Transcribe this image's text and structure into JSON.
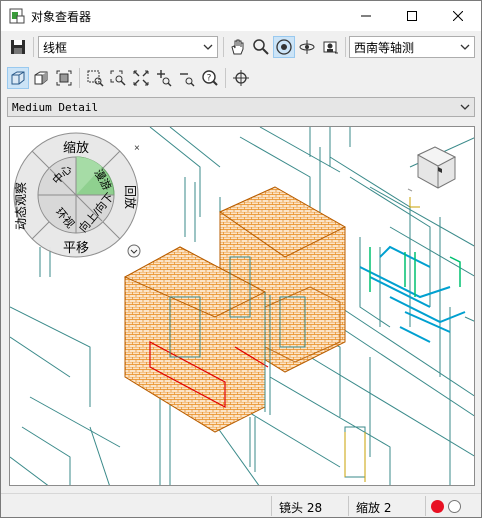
{
  "window": {
    "title": "对象查看器"
  },
  "toolbar1": {
    "visual_style_value": "线框",
    "view_value": "西南等轴测",
    "icons": [
      "save-icon",
      "pan-hand-icon",
      "zoom-icon",
      "orbit-icon",
      "constrained-orbit-icon",
      "camera-icon"
    ]
  },
  "toolbar2": {
    "icons": [
      "cube-front-icon",
      "cube-shaded-icon",
      "snapshot-icon",
      "zoom-window-icon",
      "zoom-dynamic-icon",
      "zoom-extents-icon",
      "zoom-in-icon",
      "zoom-out-icon",
      "zoom-previous-icon",
      "ucs-icon"
    ]
  },
  "detail": {
    "value": "Medium Detail"
  },
  "wheel": {
    "top": "缩放",
    "left": "动态观察",
    "right": "回放",
    "bottom": "平移",
    "center": "中心",
    "walk": "漫游",
    "look": "环视",
    "updown": "向上/向下"
  },
  "status": {
    "lens": "镜头 28",
    "zoom": "缩放 2"
  },
  "colors": {
    "accent": "#0078d7",
    "brick": "#e8891a",
    "red_dot": "#e81123",
    "edge": "#3a8a8a"
  }
}
